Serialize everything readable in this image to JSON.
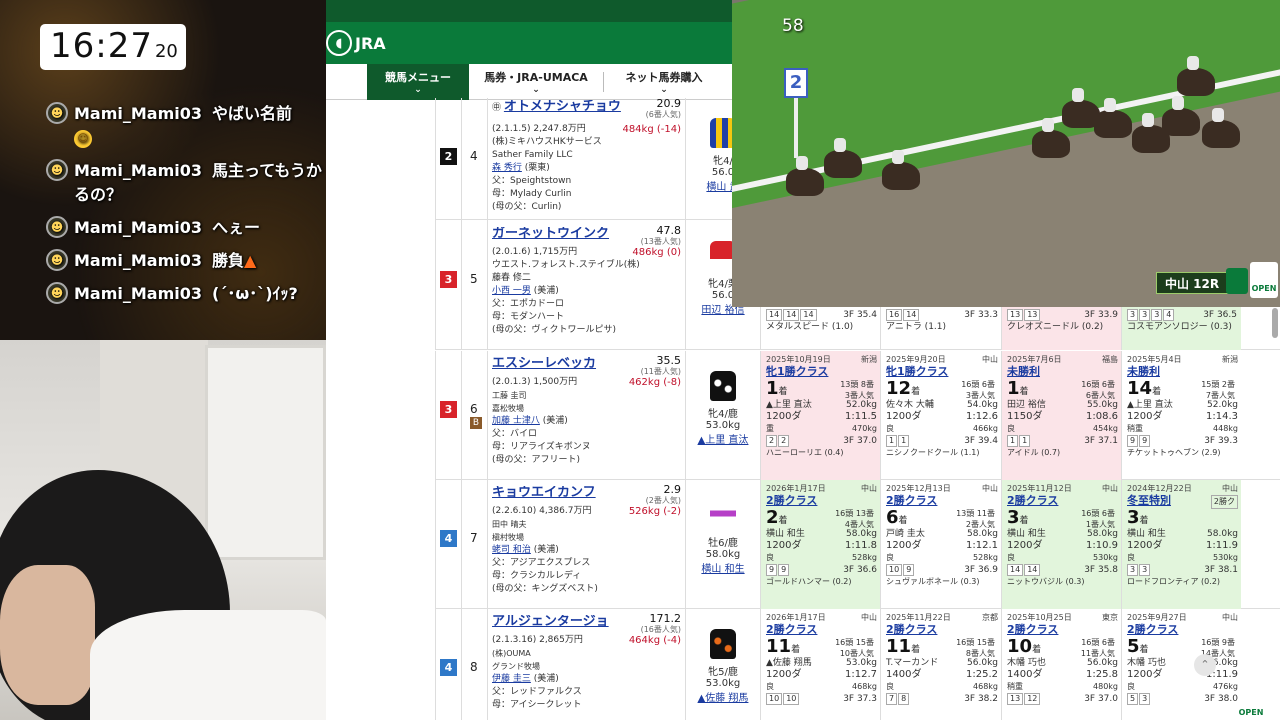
{
  "clock": {
    "hm": "16:27",
    "sec": "20"
  },
  "chat": [
    {
      "user": "Mami_Mami03",
      "text": "やばい名前",
      "extra": "🤣"
    },
    {
      "user": "Mami_Mami03",
      "text": "馬主ってもうかるの？"
    },
    {
      "user": "Mami_Mami03",
      "text": "へぇー"
    },
    {
      "user": "Mami_Mami03",
      "text": "勝負",
      "extra": "🔥"
    },
    {
      "user": "Mami_Mami03",
      "text": "(´･ω･`)ｲｯ?"
    }
  ],
  "jra": {
    "logo": "JRA",
    "nav": [
      "競馬メニュー",
      "馬券・JRA-UMACA",
      "ネット馬券購入"
    ]
  },
  "video": {
    "counter": "58",
    "pole": "2",
    "race_tag": "中山 12R",
    "open": "OPEN"
  },
  "horses": [
    {
      "waku": "2",
      "waku_color": "#111111",
      "num": "4",
      "name": "オトメナシャチョウ",
      "odds": "20.9",
      "pop": "(6番人気)",
      "record": "(2.1.1.5) 2,247.8万円",
      "weight": "484kg (-14)",
      "owner": "(株)ミキハウスHKサービス",
      "breeder": "Sather Family LLC",
      "trainer": "森 秀行",
      "trainer_loc": "(栗東)",
      "sire": "父：Speightstown",
      "dam": "母：Mylady Curlin",
      "damsire": "(母の父：Curlin)",
      "sex": "牝4/",
      "kg": "56.0",
      "jockey": "横山 武"
    },
    {
      "waku": "3",
      "waku_color": "#d8232a",
      "num": "5",
      "name": "ガーネットウインク",
      "odds": "47.8",
      "pop": "(13番人気)",
      "record": "(2.0.1.6) 1,715万円",
      "weight": "486kg (0)",
      "owner": "ウエスト.フォレスト.ステイブル(株)",
      "breeder": "藤春 修二",
      "trainer": "小西 一男",
      "trainer_loc": "(美浦)",
      "sire": "父：エポカドーロ",
      "dam": "母：モダンハート",
      "damsire": "(母の父：ヴィクトワールピサ)",
      "sex": "牝4/栗",
      "kg": "56.0",
      "jockey": "田辺 裕信",
      "past": [
        {
          "pos": [
            "14",
            "14",
            "14"
          ],
          "f3": "3F 35.4",
          "winner": "メタルスピード (1.0)"
        },
        {
          "pos": [
            "16",
            "14"
          ],
          "f3": "3F 33.3",
          "winner": "アニトラ (1.1)"
        },
        {
          "pos": [
            "13",
            "13"
          ],
          "f3": "3F 33.9",
          "winner": "クレオズニードル (0.2)"
        },
        {
          "pos": [
            "3",
            "3",
            "3",
            "4"
          ],
          "f3": "3F 36.5",
          "winner": "コスモアンソロジー (0.3)"
        }
      ]
    },
    {
      "waku": "3",
      "waku_color": "#d8232a",
      "num": "6",
      "blinker": "B",
      "name": "エスシーレベッカ",
      "odds": "35.5",
      "pop": "(11番人気)",
      "record": "(2.0.1.3) 1,500万円",
      "weight": "462kg (-8)",
      "owner": "工藤 圭司",
      "breeder": "嘉松牧場",
      "trainer": "加藤 士津八",
      "trainer_loc": "(美浦)",
      "sire": "父：バイロ",
      "dam": "母：リアライズキボンヌ",
      "damsire": "(母の父：アフリート)",
      "sex": "牝4/鹿",
      "kg": "53.0kg",
      "jockey": "▲上里 直汰",
      "past": [
        {
          "date": "2025年10月19日",
          "place": "新潟",
          "cls": "牝1勝クラス",
          "rank": "1",
          "heads": "13頭 8番",
          "popn": "3番人気",
          "jock": "▲上里 直汰",
          "jkg": "52.0kg",
          "dist": "1200ダ",
          "time": "1:11.5",
          "cond": "重",
          "hw": "470kg",
          "pos": [
            "2",
            "2"
          ],
          "f3": "3F 37.0",
          "winner": "ハニーローリエ (0.4)",
          "bg": "bg-pink"
        },
        {
          "date": "2025年9月20日",
          "place": "中山",
          "cls": "牝1勝クラス",
          "rank": "12",
          "heads": "16頭 6番",
          "popn": "3番人気",
          "jock": "佐々木 大輔",
          "jkg": "54.0kg",
          "dist": "1200ダ",
          "time": "1:12.6",
          "cond": "良",
          "hw": "466kg",
          "pos": [
            "1",
            "1"
          ],
          "f3": "3F 39.4",
          "winner": "ニシノクードクール (1.1)",
          "bg": ""
        },
        {
          "date": "2025年7月6日",
          "place": "福島",
          "cls": "未勝利",
          "rank": "1",
          "heads": "16頭 6番",
          "popn": "6番人気",
          "jock": "田辺 裕信",
          "jkg": "55.0kg",
          "dist": "1150ダ",
          "time": "1:08.6",
          "cond": "良",
          "hw": "454kg",
          "pos": [
            "1",
            "1"
          ],
          "f3": "3F 37.1",
          "winner": "アイドル (0.7)",
          "bg": "bg-pink"
        },
        {
          "date": "2025年5月4日",
          "place": "新潟",
          "cls": "未勝利",
          "rank": "14",
          "heads": "15頭 2番",
          "popn": "7番人気",
          "jock": "▲上里 直汰",
          "jkg": "52.0kg",
          "dist": "1200ダ",
          "time": "1:14.3",
          "cond": "稍重",
          "hw": "448kg",
          "pos": [
            "9",
            "9"
          ],
          "f3": "3F 39.3",
          "winner": "チケットトゥヘブン (2.9)",
          "bg": ""
        }
      ]
    },
    {
      "waku": "4",
      "waku_color": "#2e78c8",
      "num": "7",
      "name": "キョウエイカンフ",
      "odds": "2.9",
      "pop": "(2番人気)",
      "record": "(2.2.6.10) 4,386.7万円",
      "weight": "526kg (-2)",
      "owner": "田中 晴夫",
      "breeder": "槇村牧場",
      "trainer": "蛯司 和治",
      "trainer_loc": "(美浦)",
      "sire": "父：アジアエクスプレス",
      "dam": "母：クラシカルレディ",
      "damsire": "(母の父：キングズベスト)",
      "sex": "牡6/鹿",
      "kg": "58.0kg",
      "jockey": "横山 和生",
      "past": [
        {
          "date": "2026年1月17日",
          "place": "中山",
          "cls": "2勝クラス",
          "rank": "2",
          "heads": "16頭 13番",
          "popn": "4番人気",
          "jock": "横山 和生",
          "jkg": "58.0kg",
          "dist": "1200ダ",
          "time": "1:11.8",
          "cond": "良",
          "hw": "528kg",
          "pos": [
            "9",
            "9"
          ],
          "f3": "3F 36.6",
          "winner": "ゴールドハンマー (0.2)",
          "bg": "bg-green"
        },
        {
          "date": "2025年12月13日",
          "place": "中山",
          "cls": "2勝クラス",
          "rank": "6",
          "heads": "13頭 11番",
          "popn": "2番人気",
          "jock": "戸崎 圭太",
          "jkg": "58.0kg",
          "dist": "1200ダ",
          "time": "1:12.1",
          "cond": "良",
          "hw": "528kg",
          "pos": [
            "10",
            "9"
          ],
          "f3": "3F 36.9",
          "winner": "シュヴァルボネール (0.3)",
          "bg": ""
        },
        {
          "date": "2025年11月12日",
          "place": "中山",
          "cls": "2勝クラス",
          "rank": "3",
          "heads": "16頭 6番",
          "popn": "1番人気",
          "jock": "横山 和生",
          "jkg": "58.0kg",
          "dist": "1200ダ",
          "time": "1:10.9",
          "cond": "良",
          "hw": "530kg",
          "pos": [
            "14",
            "14"
          ],
          "f3": "3F 35.8",
          "winner": "ニットウバジル (0.3)",
          "bg": "bg-green"
        },
        {
          "date": "2024年12月22日",
          "place": "中山",
          "cls": "冬至特別",
          "rank": "3",
          "heads": "",
          "popn": "",
          "badge": "2勝ク",
          "jock": "横山 和生",
          "jkg": "58.0kg",
          "dist": "1200ダ",
          "time": "1:11.9",
          "cond": "良",
          "hw": "530kg",
          "pos": [
            "3",
            "3"
          ],
          "f3": "3F 38.1",
          "winner": "ロードフロンティア (0.2)",
          "bg": "bg-green"
        }
      ]
    },
    {
      "waku": "4",
      "waku_color": "#2e78c8",
      "num": "8",
      "name": "アルジェンタージョ",
      "odds": "171.2",
      "pop": "(16番人気)",
      "record": "(2.1.3.16) 2,865万円",
      "weight": "464kg (-4)",
      "owner": "(株)OUMA",
      "breeder": "グランド牧場",
      "trainer": "伊藤 圭三",
      "trainer_loc": "(美浦)",
      "sire": "父：レッドファルクス",
      "dam": "母：アイシークレット",
      "damsire": "",
      "sex": "牝5/鹿",
      "kg": "53.0kg",
      "jockey": "▲佐藤 翔馬",
      "past": [
        {
          "date": "2026年1月17日",
          "place": "中山",
          "cls": "2勝クラス",
          "rank": "11",
          "heads": "16頭 15番",
          "popn": "10番人気",
          "jock": "▲佐藤 翔馬",
          "jkg": "53.0kg",
          "dist": "1200ダ",
          "time": "1:12.7",
          "cond": "良",
          "hw": "468kg",
          "pos": [
            "10",
            "10"
          ],
          "f3": "3F 37.3",
          "winner": "",
          "bg": ""
        },
        {
          "date": "2025年11月22日",
          "place": "京都",
          "cls": "2勝クラス",
          "rank": "11",
          "heads": "16頭 15番",
          "popn": "8番人気",
          "jock": "T.マーカンド",
          "jkg": "56.0kg",
          "dist": "1400ダ",
          "time": "1:25.2",
          "cond": "良",
          "hw": "468kg",
          "pos": [
            "7",
            "8"
          ],
          "f3": "3F 38.2",
          "winner": "",
          "bg": ""
        },
        {
          "date": "2025年10月25日",
          "place": "東京",
          "cls": "2勝クラス",
          "rank": "10",
          "heads": "16頭 6番",
          "popn": "11番人気",
          "jock": "木幡 巧也",
          "jkg": "56.0kg",
          "dist": "1400ダ",
          "time": "1:25.8",
          "cond": "稍重",
          "hw": "480kg",
          "pos": [
            "13",
            "12"
          ],
          "f3": "3F 37.0",
          "winner": "",
          "bg": ""
        },
        {
          "date": "2025年9月27日",
          "place": "中山",
          "cls": "2勝クラス",
          "rank": "5",
          "heads": "16頭 9番",
          "popn": "14番人気",
          "jock": "木幡 巧也",
          "jkg": "56.0kg",
          "dist": "1200ダ",
          "time": "1:11.9",
          "cond": "良",
          "hw": "476kg",
          "pos": [
            "5",
            "3"
          ],
          "f3": "3F 38.0",
          "winner": "",
          "bg": ""
        }
      ]
    }
  ]
}
